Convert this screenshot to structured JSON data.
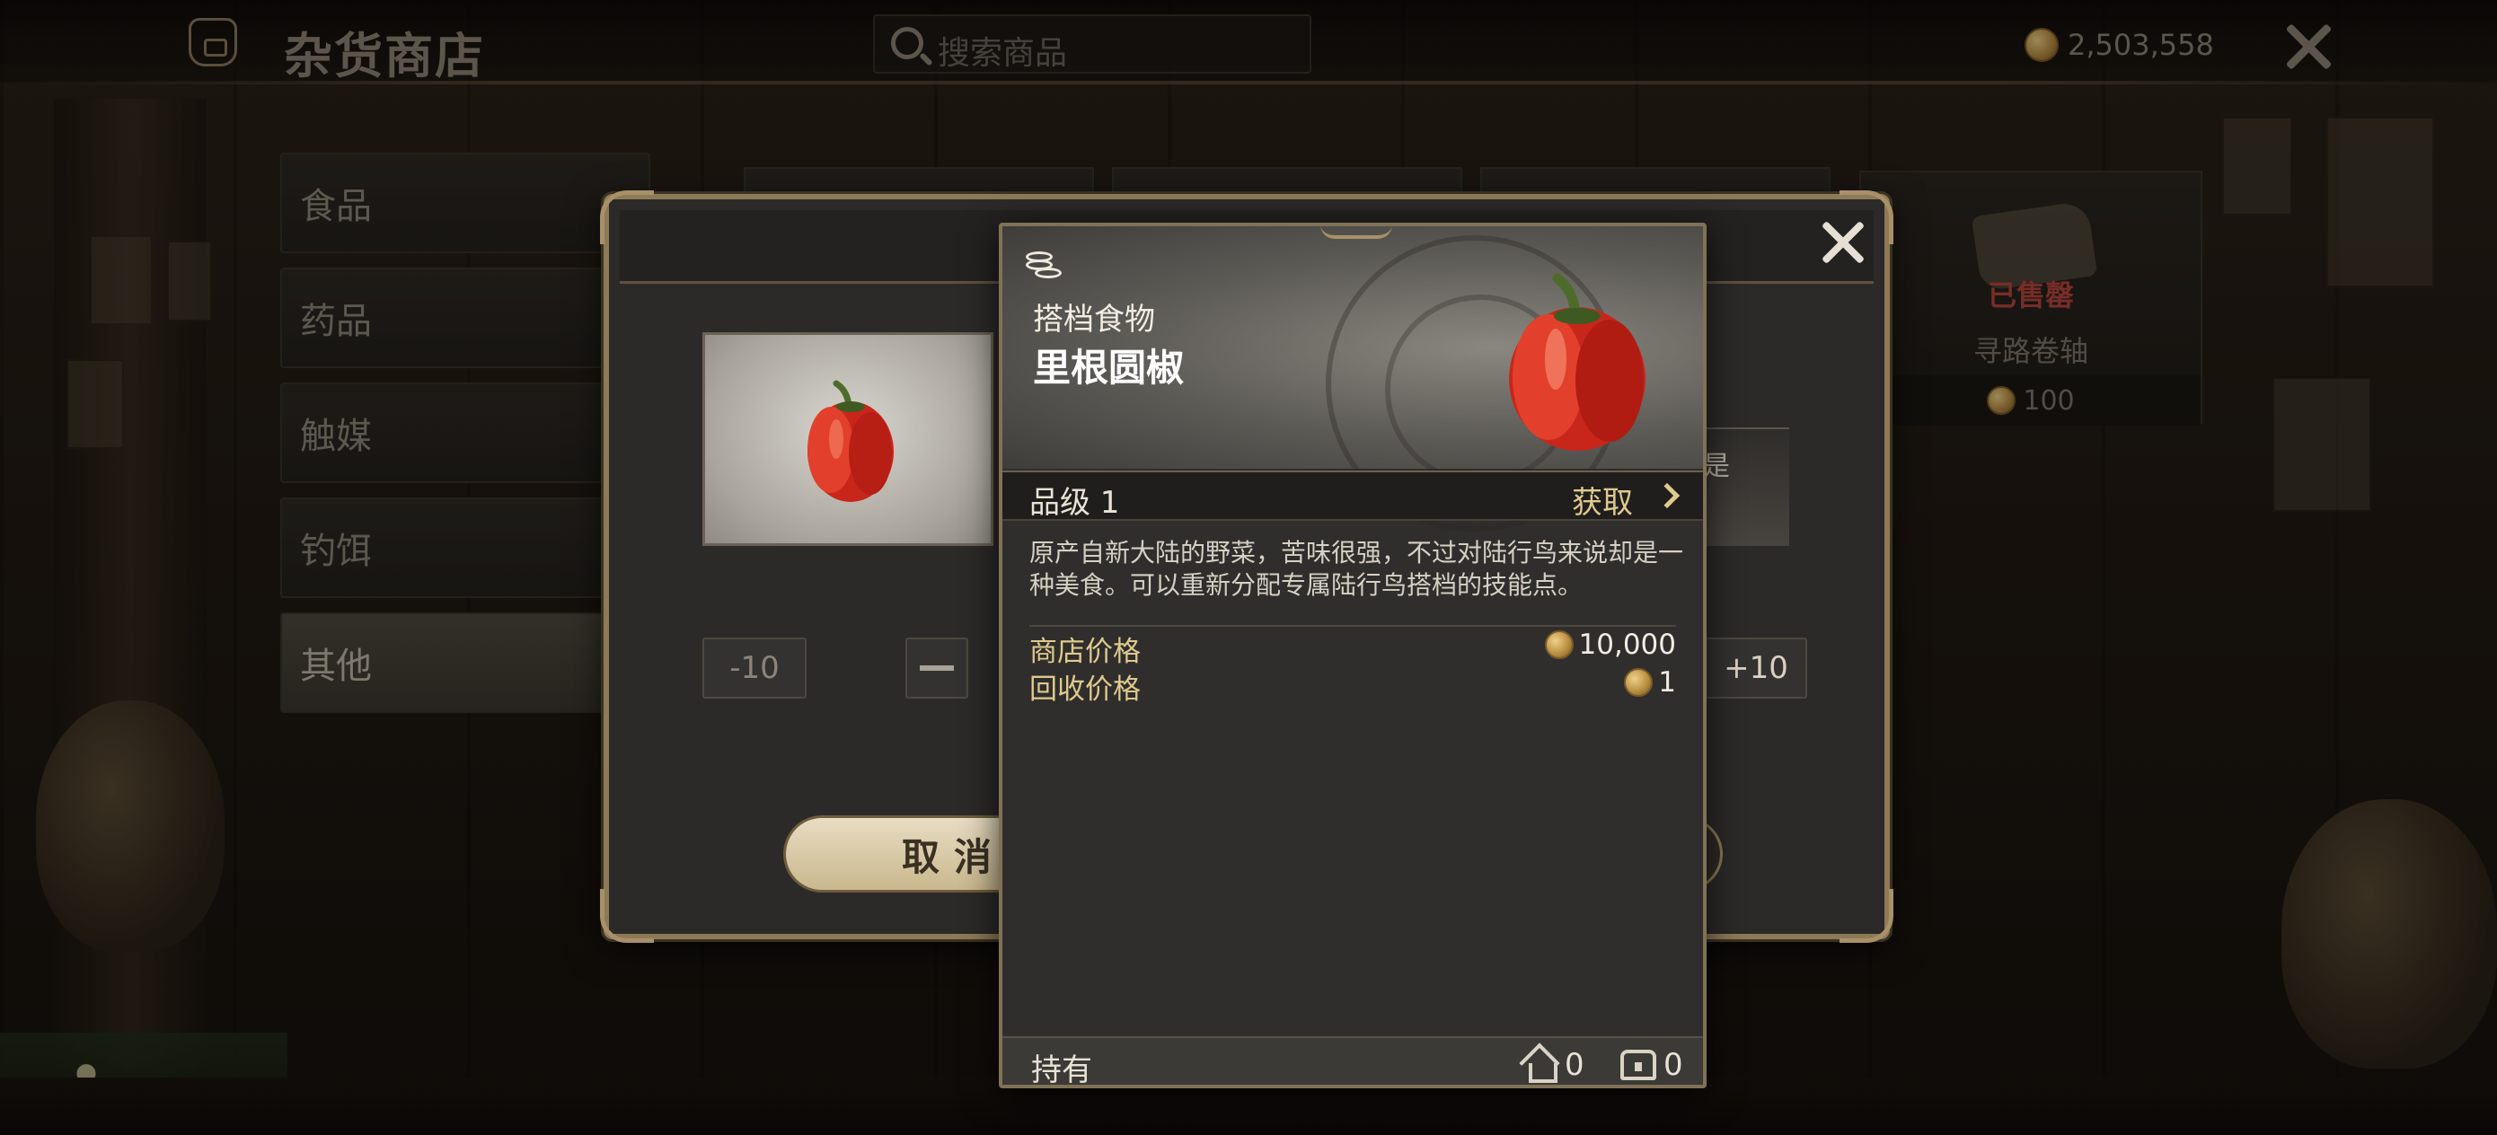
{
  "topbar": {
    "title": "杂货商店",
    "search_placeholder": "搜索商品",
    "currency_amount": "2,503,558",
    "shop_icon": "storefront-icon",
    "close_icon": "close-icon"
  },
  "sidebar": {
    "items": [
      {
        "label": "食品",
        "active": false
      },
      {
        "label": "药品",
        "active": false
      },
      {
        "label": "触媒",
        "active": false
      },
      {
        "label": "钓饵",
        "active": false
      },
      {
        "label": "其他",
        "active": true
      }
    ]
  },
  "background_products": {
    "sold_item": {
      "badge": "已售罄",
      "name": "寻路卷轴",
      "price": "100"
    }
  },
  "dialog": {
    "desc_fragment": "是",
    "minus10_label": "-10",
    "plus10_label": "+10",
    "cancel_label": "取消"
  },
  "tooltip": {
    "category": "搭档食物",
    "name": "里根圆椒",
    "grade": "品级 1",
    "obtain_label": "获取",
    "description": "原产自新大陆的野菜，苦味很强，不过对陆行鸟来说却是一种美食。可以重新分配专属陆行鸟搭档的技能点。",
    "shop_price_label": "商店价格",
    "shop_price": "10,000",
    "sell_price_label": "回收价格",
    "sell_price": "1",
    "hold_label": "持有",
    "held_inventory": "0",
    "held_storage": "0"
  },
  "colors": {
    "accent_gold": "#e0c98e",
    "frame_gold": "#8d7a56",
    "sold_red": "#b8463c"
  }
}
